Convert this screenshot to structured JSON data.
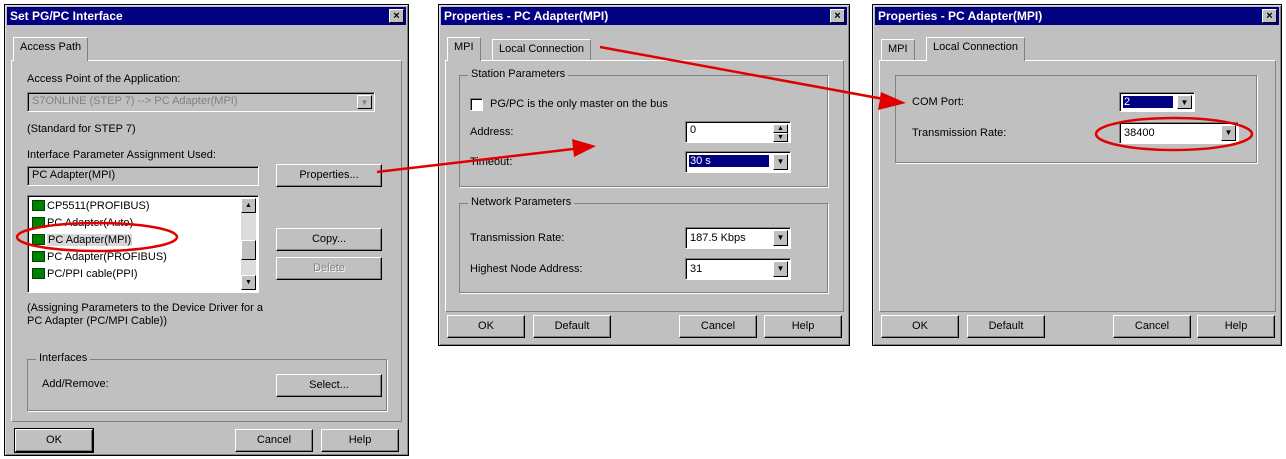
{
  "dialog1": {
    "title": "Set PG/PC Interface",
    "close_glyph": "×",
    "tab": "Access Path",
    "access_point_label": "Access Point of the Application:",
    "access_point_value": "S7ONLINE     (STEP 7)     --> PC Adapter(MPI)",
    "access_point_note": "(Standard for STEP 7)",
    "param_label": "Interface Parameter Assignment Used:",
    "param_value": "PC Adapter(MPI)",
    "properties_button": "Properties...",
    "list_items": [
      "CP5511(PROFIBUS)",
      "PC Adapter(Auto)",
      "PC Adapter(MPI)",
      "PC Adapter(PROFIBUS)",
      "PC/PPI cable(PPI)"
    ],
    "selected_index": 2,
    "copy_button": "Copy...",
    "delete_button": "Delete",
    "description": "(Assigning Parameters to the Device Driver for a PC Adapter (PC/MPI Cable))",
    "interfaces_group": "Interfaces",
    "add_remove_label": "Add/Remove:",
    "select_button": "Select...",
    "ok_button": "OK",
    "cancel_button": "Cancel",
    "help_button": "Help"
  },
  "dialog2": {
    "title": "Properties - PC Adapter(MPI)",
    "close_glyph": "×",
    "tabs": [
      "MPI",
      "Local Connection"
    ],
    "station_group": "Station Parameters",
    "only_master_label": "PG/PC is the only master on the bus",
    "address_label": "Address:",
    "address_value": "0",
    "timeout_label": "Timeout:",
    "timeout_value": "30 s",
    "network_group": "Network Parameters",
    "transmission_label": "Transmission Rate:",
    "transmission_value": "187.5 Kbps",
    "highest_node_label": "Highest Node Address:",
    "highest_node_value": "31",
    "ok_button": "OK",
    "default_button": "Default",
    "cancel_button": "Cancel",
    "help_button": "Help"
  },
  "dialog3": {
    "title": "Properties - PC Adapter(MPI)",
    "close_glyph": "×",
    "tabs": [
      "MPI",
      "Local Connection"
    ],
    "com_port_label": "COM Port:",
    "com_port_value": "2",
    "transmission_label": "Transmission Rate:",
    "transmission_value": "38400",
    "ok_button": "OK",
    "default_button": "Default",
    "cancel_button": "Cancel",
    "help_button": "Help"
  },
  "colors": {
    "title_bar": "#000080",
    "dialog_face": "#c0c0c0",
    "selection": "#000080",
    "annotation": "#e00000"
  }
}
